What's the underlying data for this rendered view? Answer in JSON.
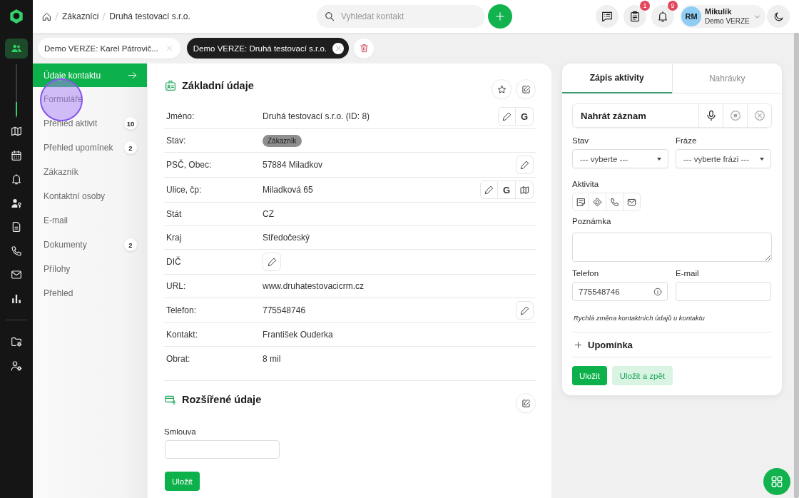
{
  "rail": {
    "top_items": [
      {
        "kind": "people",
        "selected": true
      }
    ],
    "items": [
      {
        "kind": "map",
        "selected": false
      },
      {
        "kind": "calendar",
        "selected": false
      },
      {
        "kind": "bell",
        "selected": false
      },
      {
        "kind": "person-key",
        "selected": false
      },
      {
        "kind": "document",
        "selected": false
      },
      {
        "kind": "phone",
        "selected": false
      },
      {
        "kind": "mail",
        "selected": false
      },
      {
        "kind": "chart",
        "selected": false
      }
    ],
    "bottom_items": [
      {
        "kind": "folder-settings",
        "selected": false
      },
      {
        "kind": "user-settings",
        "selected": false
      }
    ]
  },
  "breadcrumb": [
    "Zákazníci",
    "Druhá testovací s.r.o."
  ],
  "search": {
    "placeholder": "Vyhledat kontakt"
  },
  "header_buttons": [
    {
      "kind": "messages"
    },
    {
      "kind": "clipboard",
      "badge": "1"
    },
    {
      "kind": "bell",
      "badge": "9"
    }
  ],
  "user": {
    "initials": "RM",
    "name": "Mikulík",
    "subtitle": "Demo VERZE"
  },
  "open_tabs": [
    {
      "label": "Demo VERZE: Karel Pátrovič...",
      "selected": false
    },
    {
      "label": "Demo VERZE: Druhá testovací s.r.o.",
      "selected": true
    }
  ],
  "menu": [
    {
      "label": "Údaje kontaktu",
      "selected": true
    },
    {
      "label": "Formuláře",
      "selected": false
    },
    {
      "label": "Přehled aktivit",
      "selected": false,
      "badge": "10"
    },
    {
      "label": "Přehled upomínek",
      "selected": false,
      "badge": "2"
    },
    {
      "label": "Zákazník",
      "selected": false
    },
    {
      "label": "Kontaktní osoby",
      "selected": false
    },
    {
      "label": "E-mail",
      "selected": false
    },
    {
      "label": "Dokumenty",
      "selected": false,
      "badge": "2"
    },
    {
      "label": "Přílohy",
      "selected": false
    },
    {
      "label": "Přehled",
      "selected": false
    }
  ],
  "basic_info": {
    "title": "Základní údaje",
    "rows": [
      {
        "label": "Jméno:",
        "kind": "text",
        "value": "Druhá testovací s.r.o. (ID: 8)",
        "actions": [
          {
            "kind": "edit"
          },
          {
            "kind": "letter",
            "text": "G"
          }
        ]
      },
      {
        "label": "Stav:",
        "kind": "tag",
        "value": "Zákazník"
      },
      {
        "label": "PSČ, Obec:",
        "kind": "text",
        "value": "57884 Miladkov",
        "actions": [
          {
            "kind": "edit"
          }
        ]
      },
      {
        "label": "Ulice, čp:",
        "kind": "text",
        "value": "Miladková 65",
        "actions": [
          {
            "kind": "edit"
          },
          {
            "kind": "letter",
            "text": "G"
          },
          {
            "kind": "map"
          }
        ]
      },
      {
        "label": "Stát",
        "kind": "text",
        "value": "CZ"
      },
      {
        "label": "Kraj",
        "kind": "text",
        "value": "Středočeský"
      },
      {
        "label": "DIČ",
        "kind": "edit"
      },
      {
        "label": "URL:",
        "kind": "text",
        "value": "www.druhatestovacicrm.cz"
      },
      {
        "label": "Telefon:",
        "kind": "text",
        "value": "775548746",
        "actions": [
          {
            "kind": "edit"
          }
        ]
      },
      {
        "label": "Kontakt:",
        "kind": "text",
        "value": "František Ouderka"
      },
      {
        "label": "Obrat:",
        "kind": "text",
        "value": "8 mil"
      }
    ]
  },
  "extended_info": {
    "title": "Rozšířené údaje",
    "fields": [
      {
        "label": "Smlouva"
      }
    ],
    "button": "Uložit"
  },
  "activity_panel": {
    "tabs": [
      {
        "label": "Zápis aktivity",
        "selected": true
      },
      {
        "label": "Nahrávky",
        "selected": false
      }
    ],
    "recorder": {
      "label": "Nahrát záznam"
    },
    "selects": [
      {
        "label": "Stav",
        "value": "--- vyberte ---"
      },
      {
        "label": "Fráze",
        "value": "--- vyberte frázi ---"
      }
    ],
    "activity": {
      "label": "Aktivita",
      "types": [
        {
          "kind": "note",
          "selected": false
        },
        {
          "kind": "meeting",
          "selected": false
        },
        {
          "kind": "phone",
          "selected": false
        },
        {
          "kind": "email",
          "selected": false
        }
      ]
    },
    "note": {
      "label": "Poznámka"
    },
    "contact_fields": [
      {
        "label": "Telefon",
        "value": "775548746",
        "info": true
      },
      {
        "label": "E-mail",
        "info": false
      }
    ],
    "hint": "Rychlá změna kontaktních údajů u kontaktu",
    "reminder": {
      "label": "Upomínka",
      "expanded": false
    },
    "buttons": [
      {
        "label": "Uložit",
        "kind": "primary"
      },
      {
        "label": "Uložit a zpět",
        "kind": "secondary"
      }
    ]
  }
}
